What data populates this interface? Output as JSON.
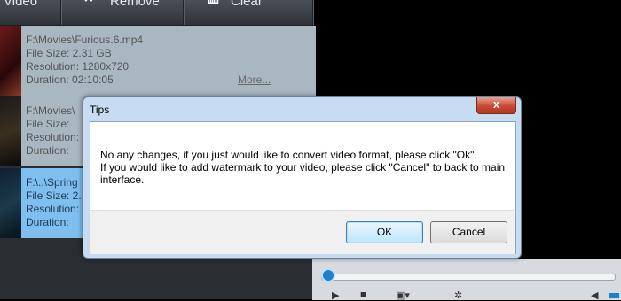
{
  "toolbar": {
    "add_label": "Video",
    "remove_label": "Remove",
    "clear_label": "Clear"
  },
  "files": [
    {
      "path": "F:\\Movies\\Furious.6.mp4",
      "size": "File Size: 2.31 GB",
      "resolution": "Resolution: 1280x720",
      "duration": "Duration: 02:10:05",
      "more": "More..."
    },
    {
      "path": "F:\\Movies\\",
      "size": "File Size:",
      "resolution": "Resolution:",
      "duration": "Duration:"
    },
    {
      "path": "F:\\..\\Spring",
      "size": "File Size: 2.",
      "resolution": "Resolution:",
      "duration": "Duration:"
    }
  ],
  "dialog": {
    "title": "Tips",
    "close": "x",
    "message_line1": "No any changes, if you just would like to convert video format, please click \"Ok\".",
    "message_line2": "If you would like to add watermark to your video, please click \"Cancel\" to back to main interface.",
    "ok_label": "OK",
    "cancel_label": "Cancel"
  }
}
